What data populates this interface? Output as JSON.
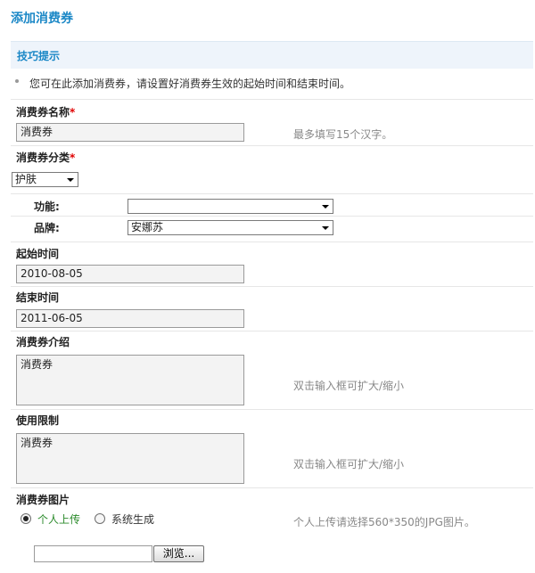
{
  "page": {
    "title": "添加消费券"
  },
  "tips": {
    "title": "技巧提示",
    "text": "您可在此添加消费券，请设置好消费券生效的起始时间和结束时间。"
  },
  "form": {
    "name": {
      "label": "消费券名称",
      "required": "*",
      "value": "消费券",
      "hint": "最多填写15个汉字。"
    },
    "category": {
      "label": "消费券分类",
      "required": "*",
      "selected": "护肤"
    },
    "function": {
      "label": "功能:",
      "selected": ""
    },
    "brand": {
      "label": "品牌:",
      "selected": "安娜苏"
    },
    "start_time": {
      "label": "起始时间",
      "value": "2010-08-05"
    },
    "end_time": {
      "label": "结束时间",
      "value": "2011-06-05"
    },
    "intro": {
      "label": "消费券介绍",
      "value": "消费券",
      "hint": "双击输入框可扩大/缩小"
    },
    "limits": {
      "label": "使用限制",
      "value": "消费券",
      "hint": "双击输入框可扩大/缩小"
    },
    "image": {
      "label": "消费券图片",
      "option_upload": "个人上传",
      "option_generate": "系统生成",
      "hint": "个人上传请选择560*350的JPG图片。",
      "browse_label": "浏览...",
      "file_value": ""
    }
  },
  "colors": {
    "accent": "#1a87c6",
    "required": "#e00000",
    "selected_option": "#2a8a2a"
  }
}
